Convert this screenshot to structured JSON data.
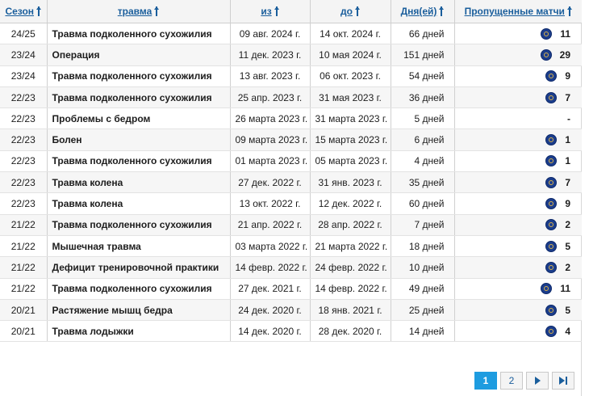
{
  "headers": {
    "season": "Сезон",
    "injury": "травма",
    "from": "из",
    "to": "до",
    "days": "Дня(ей)",
    "games": "Пропущенные матчи"
  },
  "rows": [
    {
      "season": "24/25",
      "injury": "Травма подколенного сухожилия",
      "from": "09 авг. 2024 г.",
      "to": "14 окт. 2024 г.",
      "days": "66 дней",
      "games": "11",
      "crest": true
    },
    {
      "season": "23/24",
      "injury": "Операция",
      "from": "11 дек. 2023 г.",
      "to": "10 мая 2024 г.",
      "days": "151 дней",
      "games": "29",
      "crest": true
    },
    {
      "season": "23/24",
      "injury": "Травма подколенного сухожилия",
      "from": "13 авг. 2023 г.",
      "to": "06 окт. 2023 г.",
      "days": "54 дней",
      "games": "9",
      "crest": true
    },
    {
      "season": "22/23",
      "injury": "Травма подколенного сухожилия",
      "from": "25 апр. 2023 г.",
      "to": "31 мая 2023 г.",
      "days": "36 дней",
      "games": "7",
      "crest": true
    },
    {
      "season": "22/23",
      "injury": "Проблемы с бедром",
      "from": "26 марта 2023 г.",
      "to": "31 марта 2023 г.",
      "days": "5 дней",
      "games": "-",
      "crest": false
    },
    {
      "season": "22/23",
      "injury": "Болен",
      "from": "09 марта 2023 г.",
      "to": "15 марта 2023 г.",
      "days": "6 дней",
      "games": "1",
      "crest": true
    },
    {
      "season": "22/23",
      "injury": "Травма подколенного сухожилия",
      "from": "01 марта 2023 г.",
      "to": "05 марта 2023 г.",
      "days": "4 дней",
      "games": "1",
      "crest": true
    },
    {
      "season": "22/23",
      "injury": "Травма колена",
      "from": "27 дек. 2022 г.",
      "to": "31 янв. 2023 г.",
      "days": "35 дней",
      "games": "7",
      "crest": true
    },
    {
      "season": "22/23",
      "injury": "Травма колена",
      "from": "13 окт. 2022 г.",
      "to": "12 дек. 2022 г.",
      "days": "60 дней",
      "games": "9",
      "crest": true
    },
    {
      "season": "21/22",
      "injury": "Травма подколенного сухожилия",
      "from": "21 апр. 2022 г.",
      "to": "28 апр. 2022 г.",
      "days": "7 дней",
      "games": "2",
      "crest": true
    },
    {
      "season": "21/22",
      "injury": "Мышечная травма",
      "from": "03 марта 2022 г.",
      "to": "21 марта 2022 г.",
      "days": "18 дней",
      "games": "5",
      "crest": true
    },
    {
      "season": "21/22",
      "injury": "Дефицит тренировочной практики",
      "from": "14 февр. 2022 г.",
      "to": "24 февр. 2022 г.",
      "days": "10 дней",
      "games": "2",
      "crest": true
    },
    {
      "season": "21/22",
      "injury": "Травма подколенного сухожилия",
      "from": "27 дек. 2021 г.",
      "to": "14 февр. 2022 г.",
      "days": "49 дней",
      "games": "11",
      "crest": true
    },
    {
      "season": "20/21",
      "injury": "Растяжение мышц бедра",
      "from": "24 дек. 2020 г.",
      "to": "18 янв. 2021 г.",
      "days": "25 дней",
      "games": "5",
      "crest": true
    },
    {
      "season": "20/21",
      "injury": "Травма лодыжки",
      "from": "14 дек. 2020 г.",
      "to": "28 дек. 2020 г.",
      "days": "14 дней",
      "games": "4",
      "crest": true
    }
  ],
  "pagination": {
    "current": "1",
    "next_page": "2",
    "icons": [
      "next-icon",
      "last-icon"
    ]
  },
  "colors": {
    "link": "#1a5e9c",
    "active_page": "#1e9ce0",
    "crest": "#1b3d8c"
  }
}
